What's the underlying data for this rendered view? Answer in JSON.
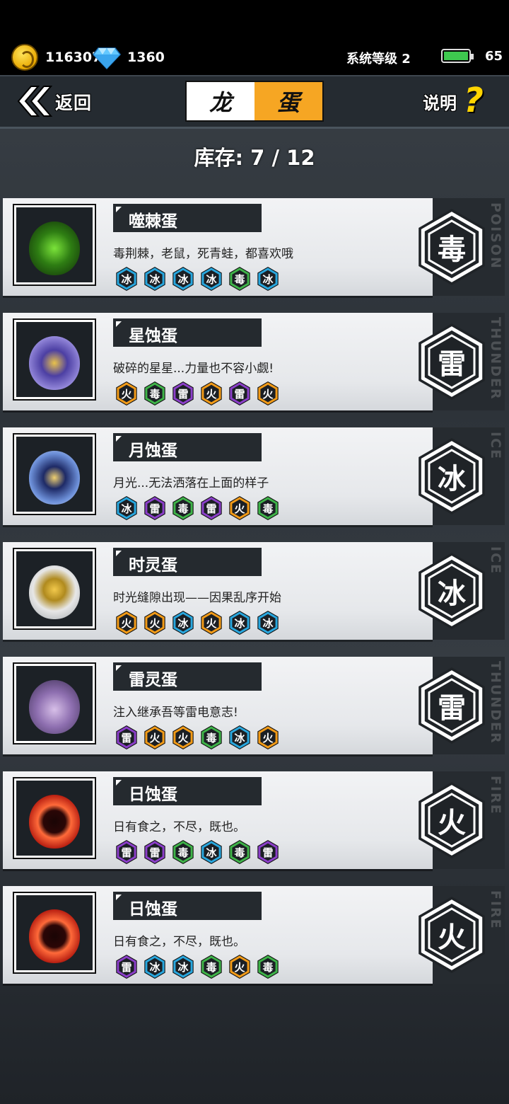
{
  "status": {
    "coins": "116307",
    "gems": "1360",
    "system_level": "系统等级 2",
    "battery": "65"
  },
  "header": {
    "back_label": "返回",
    "title_left": "龙",
    "title_right": "蛋",
    "help_label": "说明",
    "help_icon": "?"
  },
  "inventory": "库存: 7 / 12",
  "element_colors": {
    "冰": "#29a7de",
    "毒": "#3fb349",
    "雷": "#8b3fc9",
    "火": "#f29b18"
  },
  "eggs": [
    {
      "name": "噬棘蛋",
      "desc": "毒荆棘，老鼠，死青蛙，都喜欢哦",
      "badges": [
        "冰",
        "冰",
        "冰",
        "冰",
        "毒",
        "冰"
      ],
      "element": "毒",
      "side": "POISON",
      "icon": "thorn-egg-icon"
    },
    {
      "name": "星蚀蛋",
      "desc": "破碎的星星...力量也不容小觑!",
      "badges": [
        "火",
        "毒",
        "雷",
        "火",
        "雷",
        "火"
      ],
      "element": "雷",
      "side": "THUNDER",
      "icon": "star-eclipse-egg-icon"
    },
    {
      "name": "月蚀蛋",
      "desc": "月光...无法洒落在上面的样子",
      "badges": [
        "冰",
        "雷",
        "毒",
        "雷",
        "火",
        "毒"
      ],
      "element": "冰",
      "side": "ICE",
      "icon": "moon-eclipse-egg-icon"
    },
    {
      "name": "时灵蛋",
      "desc": "时光缝隙出现——因果乱序开始",
      "badges": [
        "火",
        "火",
        "冰",
        "火",
        "冰",
        "冰"
      ],
      "element": "冰",
      "side": "ICE",
      "icon": "time-spirit-egg-icon"
    },
    {
      "name": "雷灵蛋",
      "desc": "注入继承吾等雷电意志!",
      "badges": [
        "雷",
        "火",
        "火",
        "毒",
        "冰",
        "火"
      ],
      "element": "雷",
      "side": "THUNDER",
      "icon": "thunder-spirit-egg-icon"
    },
    {
      "name": "日蚀蛋",
      "desc": "日有食之，不尽，既也。",
      "badges": [
        "雷",
        "雷",
        "毒",
        "冰",
        "毒",
        "雷"
      ],
      "element": "火",
      "side": "FIRE",
      "icon": "sun-eclipse-egg-icon"
    },
    {
      "name": "日蚀蛋",
      "desc": "日有食之，不尽，既也。",
      "badges": [
        "雷",
        "冰",
        "冰",
        "毒",
        "火",
        "毒"
      ],
      "element": "火",
      "side": "FIRE",
      "icon": "sun-eclipse-egg-icon"
    }
  ]
}
